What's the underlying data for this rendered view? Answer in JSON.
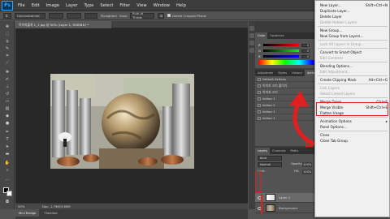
{
  "app": {
    "logo": "Ps"
  },
  "menubar": {
    "items": [
      "File",
      "Edit",
      "Image",
      "Layer",
      "Type",
      "Select",
      "Filter",
      "View",
      "Window",
      "Help"
    ]
  },
  "options": {
    "ratio": "Unconstrained",
    "straighten": "Straighten",
    "view_label": "View:",
    "view_value": "Rule of Thirds",
    "delete_cropped": "Delete Cropped Pixels"
  },
  "document": {
    "tab_title": "이미지출처 1_1.jpg @ 50% (Layer 1, RGB/8#) *",
    "zoom": "50%",
    "doc_size": "Doc: 1.79M/3.69M"
  },
  "bottom_tabs": [
    "Mini Bridge",
    "Timeline"
  ],
  "panels": {
    "color_tabs": [
      "Color",
      "Swatches"
    ],
    "sliders": [
      {
        "label": "R",
        "value": "0",
        "gradient": "#ff0000"
      },
      {
        "label": "G",
        "value": "0",
        "gradient": "#00ff00"
      },
      {
        "label": "B",
        "value": "0",
        "gradient": "#0000ff"
      }
    ],
    "adjust_tabs": [
      "Adjustmen",
      "Styles",
      "History",
      "Actions"
    ],
    "actions": [
      "Default Actions",
      "이미지 크기 줄이기",
      "이미지 크기",
      "Action 1",
      "Action 2",
      "Action 1",
      "Action 1"
    ],
    "layers_tabs": [
      "Layers",
      "Channels",
      "Paths"
    ],
    "kind_label": "Kind",
    "mode": "Normal",
    "opacity_label": "Opacity:",
    "opacity_value": "100%",
    "lock_label": "Lock:",
    "fill_label": "Fill:",
    "fill_value": "100%",
    "layers": [
      {
        "name": "Layer 1",
        "selected": true
      },
      {
        "name": "Background",
        "selected": false
      }
    ]
  },
  "context_menu": {
    "items": [
      {
        "label": "New Layer...",
        "shortcut": "Shift+Ctrl+N",
        "disabled": false
      },
      {
        "label": "Duplicate Layer...",
        "shortcut": "",
        "disabled": false
      },
      {
        "label": "Delete Layer",
        "shortcut": "",
        "disabled": false
      },
      {
        "label": "Delete Hidden Layers",
        "shortcut": "",
        "disabled": true
      },
      {
        "label": "New Group...",
        "shortcut": "",
        "disabled": false
      },
      {
        "label": "New Group from Layers...",
        "shortcut": "",
        "disabled": false
      },
      {
        "label": "Lock All Layers in Group...",
        "shortcut": "",
        "disabled": true
      },
      {
        "label": "Convert to Smart Object",
        "shortcut": "",
        "disabled": false
      },
      {
        "label": "Edit Contents",
        "shortcut": "",
        "disabled": true
      },
      {
        "label": "Blending Options...",
        "shortcut": "",
        "disabled": false
      },
      {
        "label": "Edit Adjustment...",
        "shortcut": "",
        "disabled": true
      },
      {
        "label": "Create Clipping Mask",
        "shortcut": "Alt+Ctrl+G",
        "disabled": false
      },
      {
        "label": "Link Layers",
        "shortcut": "",
        "disabled": true
      },
      {
        "label": "Select Linked Layers",
        "shortcut": "",
        "disabled": true
      },
      {
        "label": "Merge Down",
        "shortcut": "Ctrl+E",
        "disabled": false
      },
      {
        "label": "Merge Visible",
        "shortcut": "Shift+Ctrl+E",
        "disabled": false
      },
      {
        "label": "Flatten Image",
        "shortcut": "",
        "disabled": false
      },
      {
        "label": "Animation Options",
        "shortcut": "",
        "disabled": false
      },
      {
        "label": "Panel Options...",
        "shortcut": "",
        "disabled": false
      },
      {
        "label": "Close",
        "shortcut": "",
        "disabled": false
      },
      {
        "label": "Close Tab Group",
        "shortcut": "",
        "disabled": false
      }
    ]
  },
  "colors": {
    "highlight": "#e02020"
  }
}
